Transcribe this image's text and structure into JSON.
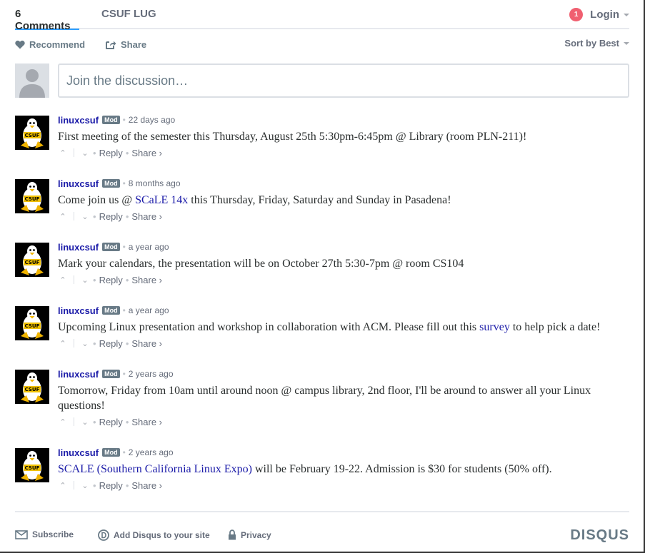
{
  "nav": {
    "comments_tab": "6 Comments",
    "community_tab": "CSUF LUG",
    "notification_count": "1",
    "login_label": "Login"
  },
  "actions": {
    "recommend_label": "Recommend",
    "share_label": "Share",
    "sort_label": "Sort by Best"
  },
  "composer": {
    "placeholder": "Join the discussion…"
  },
  "comments": [
    {
      "author": "linuxcsuf",
      "badge": "Mod",
      "time": "22 days ago",
      "text_before": "First meeting of the semester this Thursday, August 25th 5:30pm-6:45pm @ Library (room PLN-211)!",
      "link": "",
      "text_after": ""
    },
    {
      "author": "linuxcsuf",
      "badge": "Mod",
      "time": "8 months ago",
      "text_before": "Come join us @ ",
      "link": "SCaLE 14x",
      "text_after": " this Thursday, Friday, Saturday and Sunday in Pasadena!"
    },
    {
      "author": "linuxcsuf",
      "badge": "Mod",
      "time": "a year ago",
      "text_before": "Mark your calendars, the presentation will be on October 27th 5:30-7pm @ room CS104",
      "link": "",
      "text_after": ""
    },
    {
      "author": "linuxcsuf",
      "badge": "Mod",
      "time": "a year ago",
      "text_before": "Upcoming Linux presentation and workshop in collaboration with ACM. Please fill out this ",
      "link": "survey",
      "text_after": " to help pick a date!"
    },
    {
      "author": "linuxcsuf",
      "badge": "Mod",
      "time": "2 years ago",
      "text_before": "Tomorrow, Friday from 10am until around noon @ campus library, 2nd floor, I'll be around to answer all your Linux questions!",
      "link": "",
      "text_after": ""
    },
    {
      "author": "linuxcsuf",
      "badge": "Mod",
      "time": "2 years ago",
      "text_before": "",
      "link": "SCALE (Southern California Linux Expo)",
      "text_after": " will be February 19-22. Admission is $30 for students (50% off)."
    }
  ],
  "comment_actions": {
    "reply_label": "Reply",
    "share_label": "Share ›"
  },
  "avatar_text": "CSUF",
  "footer": {
    "subscribe_label": "Subscribe",
    "add_disqus_label": "Add Disqus to your site",
    "privacy_label": "Privacy",
    "brand": "DISQUS"
  }
}
